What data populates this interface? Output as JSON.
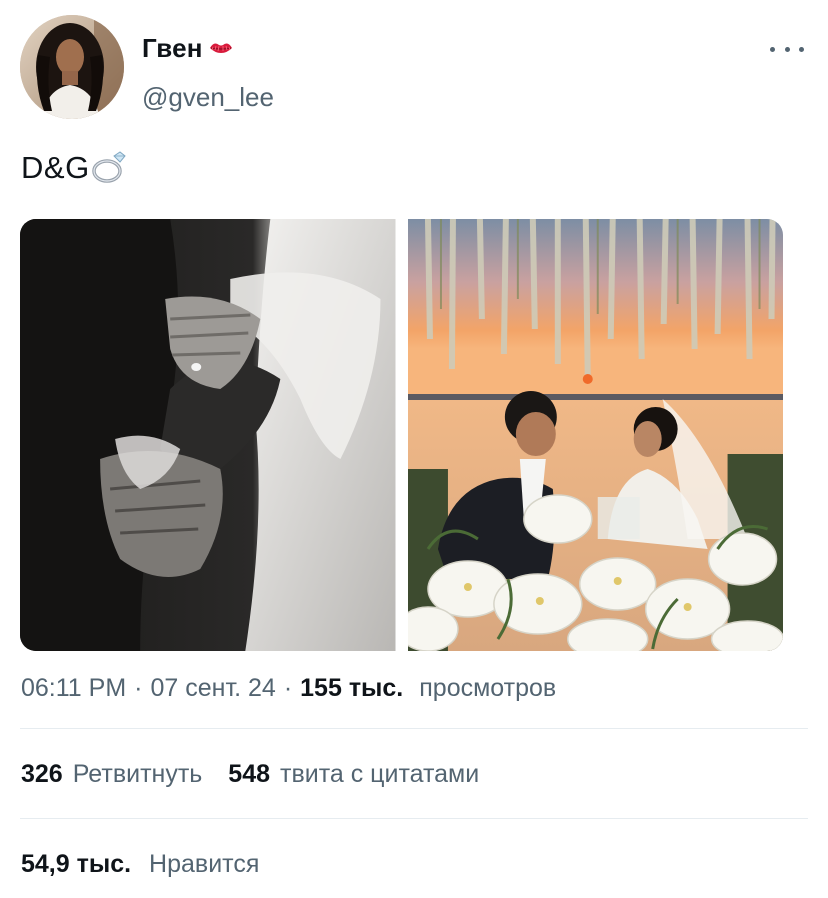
{
  "author": {
    "display_name": "Гвен",
    "handle": "@gven_lee",
    "avatar_icon": "avatar-photo",
    "name_emoji": "kiss-mark-icon"
  },
  "menu": {
    "more_icon": "more-horizontal-icon"
  },
  "tweet": {
    "text": "D&G",
    "text_emoji": "ring-icon"
  },
  "media": [
    {
      "kind": "photo",
      "label": "photo-hands-black-and-white"
    },
    {
      "kind": "photo",
      "label": "photo-couple-at-sunset"
    }
  ],
  "meta": {
    "time": "06:11 PM",
    "separator": "·",
    "date": "07 сент. 24",
    "views_count": "155 тыс.",
    "views_label": "просмотров"
  },
  "stats": {
    "retweets_count": "326",
    "retweets_label": "Ретвитнуть",
    "quotes_count": "548",
    "quotes_label": "твита с цитатами",
    "likes_count": "54,9 тыс.",
    "likes_label": "Нравится"
  },
  "colors": {
    "text_primary": "#0f1419",
    "text_secondary": "#536471",
    "divider": "#e6ecf0"
  }
}
